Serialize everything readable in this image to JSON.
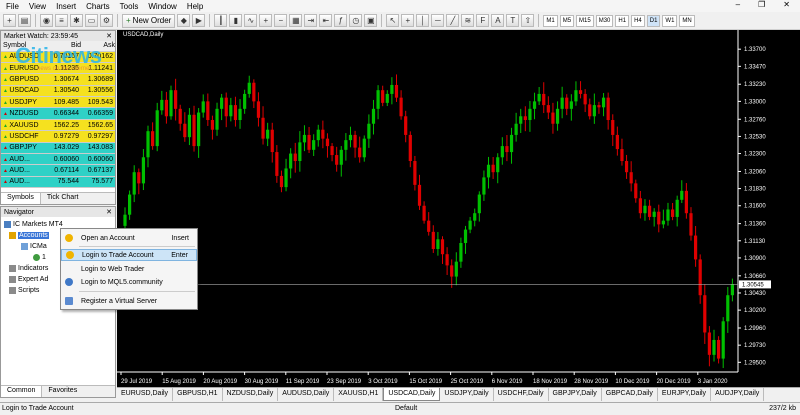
{
  "menu": {
    "items": [
      "File",
      "View",
      "Insert",
      "Charts",
      "Tools",
      "Window",
      "Help"
    ]
  },
  "toolbar": {
    "new_order": "New Order",
    "timeframes": [
      "M1",
      "M5",
      "M15",
      "M30",
      "H1",
      "H4",
      "D1",
      "W1",
      "MN"
    ],
    "active_tf": "D1"
  },
  "market_watch": {
    "title": "Market Watch: 23:59:45",
    "headers": [
      "Symbol",
      "Bid",
      "Ask"
    ],
    "rows": [
      {
        "symbol": "AUDUSD",
        "bid": "0.70157",
        "ask": "0.70162",
        "color": "#f5e11f"
      },
      {
        "symbol": "EURUSD",
        "bid": "1.11235",
        "ask": "1.11241",
        "color": "#f5e11f"
      },
      {
        "symbol": "GBPUSD",
        "bid": "1.30674",
        "ask": "1.30689",
        "color": "#f5e11f"
      },
      {
        "symbol": "USDCAD",
        "bid": "1.30540",
        "ask": "1.30556",
        "color": "#f5e11f"
      },
      {
        "symbol": "USDJPY",
        "bid": "109.485",
        "ask": "109.543",
        "color": "#f5e11f"
      },
      {
        "symbol": "NZDUSD",
        "bid": "0.66344",
        "ask": "0.66359",
        "color": "#2fd1c6"
      },
      {
        "symbol": "XAUUSD",
        "bid": "1562.25",
        "ask": "1562.65",
        "color": "#f5e11f"
      },
      {
        "symbol": "USDCHF",
        "bid": "0.97279",
        "ask": "0.97297",
        "color": "#f5e11f"
      },
      {
        "symbol": "GBPJPY",
        "bid": "143.029",
        "ask": "143.083",
        "color": "#2fd1c6"
      },
      {
        "symbol": "AUD...",
        "bid": "0.60060",
        "ask": "0.60060",
        "color": "#2fd1c6"
      },
      {
        "symbol": "AUD...",
        "bid": "0.67114",
        "ask": "0.67137",
        "color": "#2fd1c6"
      },
      {
        "symbol": "AUD...",
        "bid": "75.544",
        "ask": "75.577",
        "color": "#2fd1c6"
      }
    ],
    "tabs": [
      "Symbols",
      "Tick Chart"
    ]
  },
  "navigator": {
    "title": "Navigator",
    "items": [
      "IC Markets MT4",
      "Accounts",
      "ICMa",
      "1",
      "Indicators",
      "Expert Ad",
      "Scripts"
    ],
    "tabs": [
      "Common",
      "Favorites"
    ]
  },
  "context_menu": {
    "items": [
      {
        "label": "Open an Account",
        "shortcut": "Insert"
      },
      {
        "label": "Login to Trade Account",
        "shortcut": "Enter"
      },
      {
        "label": "Login to Web Trader",
        "shortcut": ""
      },
      {
        "label": "Login to MQL5.community",
        "shortcut": ""
      },
      {
        "label": "Register a Virtual Server",
        "shortcut": ""
      }
    ]
  },
  "watermark": {
    "brand": "Citinews",
    "tagline": "news on the internet"
  },
  "chart": {
    "title": "USDCAD,Daily",
    "current_price": "1.30545"
  },
  "chart_data": {
    "type": "candlestick",
    "title": "USDCAD,Daily",
    "y_ticks": [
      "1.33700",
      "1.33470",
      "1.33230",
      "1.33000",
      "1.32760",
      "1.32530",
      "1.32300",
      "1.32060",
      "1.31830",
      "1.31600",
      "1.31360",
      "1.31130",
      "1.30900",
      "1.30660",
      "1.30430",
      "1.30200",
      "1.29960",
      "1.29730",
      "1.29500"
    ],
    "x_ticks": [
      "29 Jul 2019",
      "15 Aug 2019",
      "20 Aug 2019",
      "30 Aug 2019",
      "11 Sep 2019",
      "23 Sep 2019",
      "3 Oct 2019",
      "15 Oct 2019",
      "25 Oct 2019",
      "6 Nov 2019",
      "18 Nov 2019",
      "28 Nov 2019",
      "10 Dec 2019",
      "20 Dec 2019",
      "3 Jan 2020"
    ],
    "ylim": [
      1.2937,
      1.3385
    ],
    "up_color": "#00c000",
    "down_color": "#e00000",
    "closes": [
      1.3148,
      1.3175,
      1.3205,
      1.319,
      1.3225,
      1.326,
      1.324,
      1.3288,
      1.3302,
      1.328,
      1.3315,
      1.329,
      1.327,
      1.3252,
      1.3282,
      1.324,
      1.3285,
      1.33,
      1.3275,
      1.3262,
      1.329,
      1.3305,
      1.328,
      1.3295,
      1.3275,
      1.329,
      1.331,
      1.3325,
      1.33,
      1.3278,
      1.325,
      1.3262,
      1.3232,
      1.32,
      1.3185,
      1.321,
      1.323,
      1.322,
      1.3245,
      1.3255,
      1.3235,
      1.3248,
      1.3262,
      1.325,
      1.324,
      1.3228,
      1.3215,
      1.3235,
      1.3248,
      1.3255,
      1.3238,
      1.3225,
      1.325,
      1.327,
      1.329,
      1.3315,
      1.3298,
      1.331,
      1.3322,
      1.3305,
      1.328,
      1.3255,
      1.322,
      1.3188,
      1.316,
      1.314,
      1.3125,
      1.3102,
      1.3115,
      1.3095,
      1.308,
      1.3065,
      1.3085,
      1.311,
      1.3128,
      1.314,
      1.315,
      1.3175,
      1.3198,
      1.3215,
      1.3205,
      1.3225,
      1.324,
      1.3232,
      1.3255,
      1.327,
      1.328,
      1.3275,
      1.329,
      1.33,
      1.331,
      1.3295,
      1.3285,
      1.327,
      1.329,
      1.3305,
      1.329,
      1.33,
      1.3315,
      1.331,
      1.3296,
      1.328,
      1.3295,
      1.3292,
      1.3305,
      1.3275,
      1.3255,
      1.3236,
      1.322,
      1.3205,
      1.319,
      1.317,
      1.315,
      1.316,
      1.3145,
      1.3152,
      1.3135,
      1.314,
      1.3155,
      1.3145,
      1.3168,
      1.318,
      1.315,
      1.312,
      1.3088,
      1.304,
      1.299,
      1.296,
      1.298,
      1.2955,
      1.3005,
      1.304,
      1.3055
    ]
  },
  "chart_tabs": {
    "items": [
      "EURUSD,Daily",
      "GBPUSD,H1",
      "NZDUSD,Daily",
      "AUDUSD,Daily",
      "XAUUSD,H1",
      "USDCAD,Daily",
      "USDJPY,Daily",
      "USDCHF,Daily",
      "GBPJPY,Daily",
      "GBPCAD,Daily",
      "EURJPY,Daily",
      "AUDJPY,Daily"
    ],
    "active": "USDCAD,Daily"
  },
  "status": {
    "left": "Login to Trade Account",
    "middle": "Default",
    "right": "237/2 kb"
  }
}
